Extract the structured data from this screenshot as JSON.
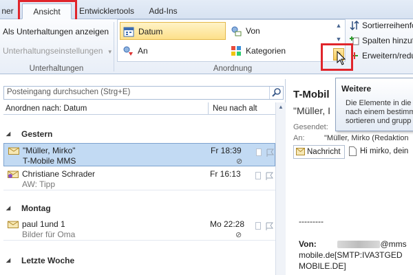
{
  "ribbon_tabs": [
    {
      "label": "ner",
      "active": false
    },
    {
      "label": "Ansicht",
      "active": true
    },
    {
      "label": "Entwicklertools",
      "active": false
    },
    {
      "label": "Add-Ins",
      "active": false
    }
  ],
  "ribbon": {
    "show_conversations": "Als Unterhaltungen anzeigen",
    "conversation_settings": "Unterhaltungseinstellungen",
    "group_conversations": "Unterhaltungen",
    "arrangement_items": [
      {
        "label": "Datum",
        "selected": true
      },
      {
        "label": "Von",
        "selected": false
      },
      {
        "label": "An",
        "selected": false
      },
      {
        "label": "Kategorien",
        "selected": false
      }
    ],
    "group_arrangement": "Anordnung",
    "side_items": [
      "Sortierreihenfo",
      "Spalten hinzuf",
      "Erweitern/redu"
    ]
  },
  "tooltip": {
    "title": "Weitere",
    "lines": [
      "Die Elemente in die",
      "nach einem bestimm",
      "sortieren und grupp"
    ]
  },
  "list": {
    "search_placeholder": "Posteingang durchsuchen (Strg+E)",
    "sort_by": "Anordnen nach: Datum",
    "sort_order": "Neu nach alt",
    "groups": [
      {
        "label": "Gestern",
        "mails": [
          {
            "from": "\"Müller, Mirko\"",
            "subject": "T-Mobile MMS",
            "time": "Fr 18:39",
            "attachment": true,
            "selected": true
          },
          {
            "from": "Christiane Schrader",
            "subject": "AW: Tipp",
            "time": "Fr 16:13",
            "attachment": false,
            "selected": false
          }
        ]
      },
      {
        "label": "Montag",
        "mails": [
          {
            "from": "paul 1und 1",
            "subject": "Bilder für Oma",
            "time": "Mo 22:28",
            "attachment": true,
            "selected": false
          }
        ]
      },
      {
        "label": "Letzte Woche",
        "mails": []
      }
    ]
  },
  "reading": {
    "title": "T-Mobil",
    "from": "\"Müller, I",
    "sent_label": "Gesendet:",
    "to_label": "An:",
    "to_value": "\"Müller, Mirko (Redaktion",
    "tab_message": "Nachricht",
    "tab_attachment": "Hi mirko, dein",
    "separator": "---------",
    "body_from_label": "Von:",
    "body_line1_tail": "@mms",
    "body_line2": "mobile.de[SMTP:IVA3TGED",
    "body_line3": "MOBILE.DE]"
  },
  "colors": {
    "selection": "#c2daf3",
    "accent_red": "#e0252b",
    "ribbon_highlight": "#fde08a"
  }
}
